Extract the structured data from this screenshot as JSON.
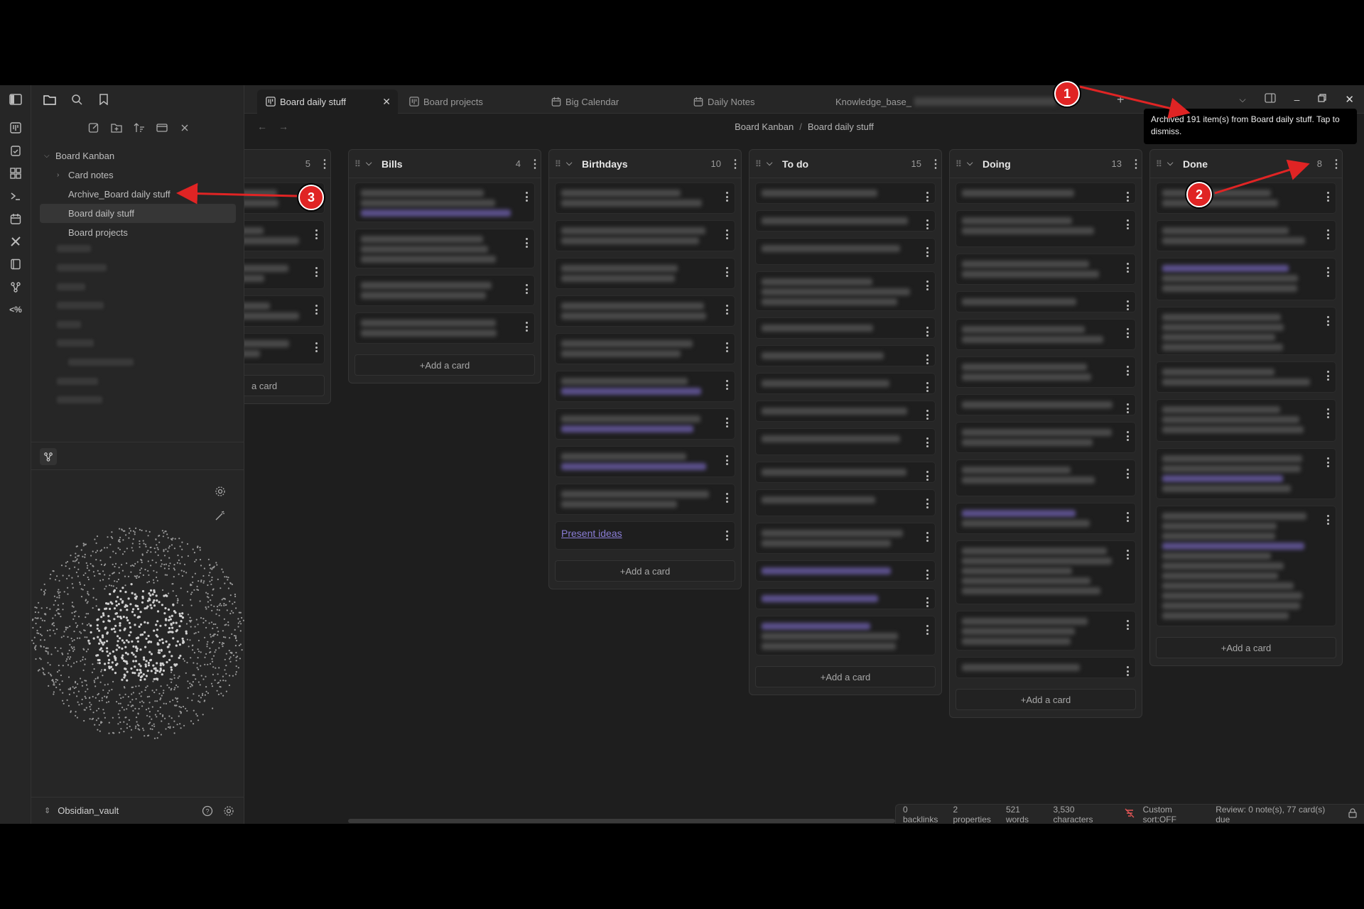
{
  "tabs": [
    {
      "label": "Board daily stuff",
      "icon": "kanban-icon",
      "active": true
    },
    {
      "label": "Board projects",
      "icon": "kanban-icon",
      "active": false
    },
    {
      "label": "Big Calendar",
      "icon": "calendar-icon",
      "active": false
    },
    {
      "label": "Daily Notes",
      "icon": "calendar-icon",
      "active": false
    },
    {
      "label": "Knowledge_base_",
      "icon": "",
      "active": false
    }
  ],
  "breadcrumb": {
    "parent": "Board Kanban",
    "sep": "/",
    "current": "Board daily stuff"
  },
  "sidebar": {
    "tree": [
      {
        "label": "Board Kanban",
        "level": 0,
        "expanded": true
      },
      {
        "label": "Card notes",
        "level": 1,
        "expanded": false
      },
      {
        "label": "Archive_Board daily stuff",
        "level": 1
      },
      {
        "label": "Board daily stuff",
        "level": 1,
        "selected": true
      },
      {
        "label": "Board projects",
        "level": 1
      }
    ],
    "vault_name": "Obsidian_vault"
  },
  "lanes": [
    {
      "title": "",
      "count": "5",
      "add_label": "+Add a card"
    },
    {
      "title": "Bills",
      "count": "4",
      "add_label": "+Add a card"
    },
    {
      "title": "Birthdays",
      "count": "10",
      "add_label": "+Add a card",
      "link_card": "Present ideas"
    },
    {
      "title": "To do",
      "count": "15",
      "add_label": "+Add a card"
    },
    {
      "title": "Doing",
      "count": "13",
      "add_label": "+Add a card"
    },
    {
      "title": "Done",
      "count": "8",
      "add_label": "+Add a card"
    }
  ],
  "partial_add_label": "a card",
  "tooltip": "Archived 191 item(s) from Board daily stuff. Tap to dismiss.",
  "status": {
    "backlinks": "0 backlinks",
    "properties": "2 properties",
    "words": "521 words",
    "characters": "3,530 characters",
    "sort": "Custom sort:OFF",
    "review": "Review: 0 note(s), 77 card(s) due"
  },
  "annotations": [
    "1",
    "2",
    "3"
  ],
  "colors": {
    "accent": "#8a7dd6",
    "annotation": "#e02424",
    "background": "#1e1e1e",
    "panel": "#262626"
  }
}
